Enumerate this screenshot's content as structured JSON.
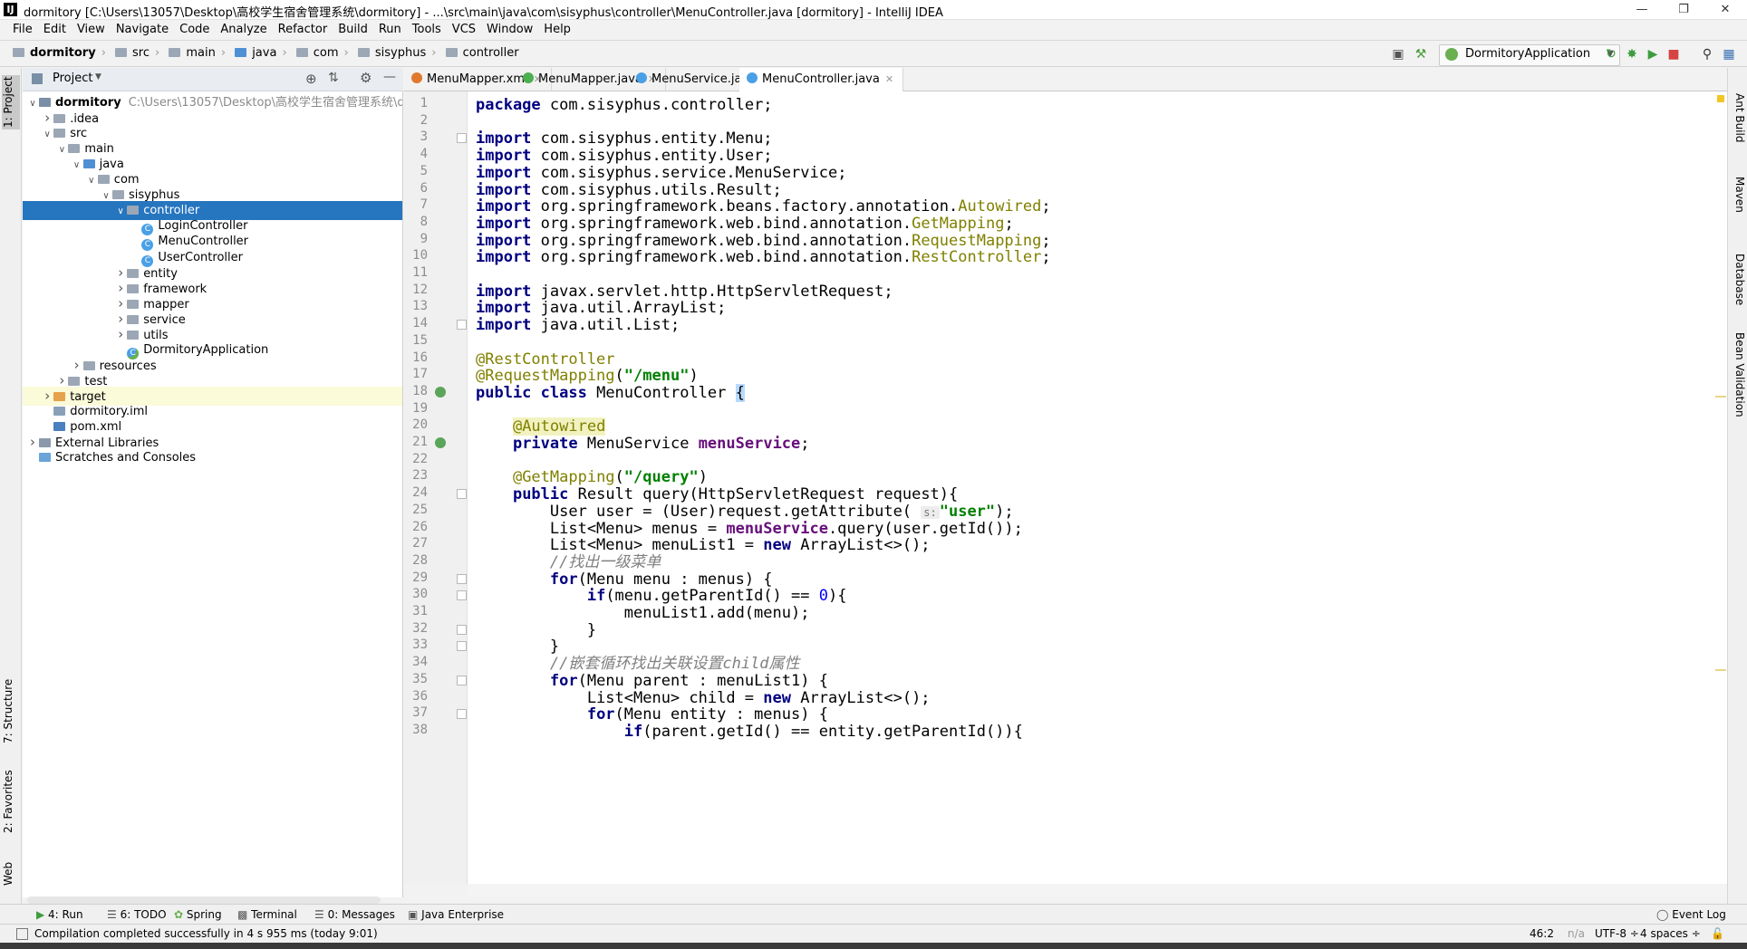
{
  "window": {
    "title": "dormitory [C:\\Users\\13057\\Desktop\\高校学生宿舍管理系统\\dormitory] - ...\\src\\main\\java\\com\\sisyphus\\controller\\MenuController.java [dormitory] - IntelliJ IDEA",
    "logo": "IJ"
  },
  "menu": [
    "File",
    "Edit",
    "View",
    "Navigate",
    "Code",
    "Analyze",
    "Refactor",
    "Build",
    "Run",
    "Tools",
    "VCS",
    "Window",
    "Help"
  ],
  "breadcrumb": [
    "dormitory",
    "src",
    "main",
    "java",
    "com",
    "sisyphus",
    "controller"
  ],
  "run_config": "DormitoryApplication",
  "left_stripe": [
    "1: Project",
    "7: Structure",
    "2: Favorites",
    "Web"
  ],
  "right_stripe": [
    "Ant Build",
    "Maven",
    "Database",
    "Bean Validation"
  ],
  "project_panel": {
    "title": "Project",
    "root_path": "C:\\Users\\13057\\Desktop\\高校学生宿舍管理系统\\dormi",
    "tree": [
      {
        "label": "dormitory",
        "depth": 0,
        "arrow": "down",
        "icon": "module",
        "bold": true
      },
      {
        "label": ".idea",
        "depth": 1,
        "arrow": "right",
        "icon": "folder"
      },
      {
        "label": "src",
        "depth": 1,
        "arrow": "down",
        "icon": "folder"
      },
      {
        "label": "main",
        "depth": 2,
        "arrow": "down",
        "icon": "folder"
      },
      {
        "label": "java",
        "depth": 3,
        "arrow": "down",
        "icon": "folder-blue"
      },
      {
        "label": "com",
        "depth": 4,
        "arrow": "down",
        "icon": "folder"
      },
      {
        "label": "sisyphus",
        "depth": 5,
        "arrow": "down",
        "icon": "folder"
      },
      {
        "label": "controller",
        "depth": 6,
        "arrow": "down",
        "icon": "folder",
        "selected": true
      },
      {
        "label": "LoginController",
        "depth": 7,
        "arrow": "",
        "icon": "class"
      },
      {
        "label": "MenuController",
        "depth": 7,
        "arrow": "",
        "icon": "class"
      },
      {
        "label": "UserController",
        "depth": 7,
        "arrow": "",
        "icon": "class"
      },
      {
        "label": "entity",
        "depth": 6,
        "arrow": "right",
        "icon": "folder"
      },
      {
        "label": "framework",
        "depth": 6,
        "arrow": "right",
        "icon": "folder"
      },
      {
        "label": "mapper",
        "depth": 6,
        "arrow": "right",
        "icon": "folder"
      },
      {
        "label": "service",
        "depth": 6,
        "arrow": "right",
        "icon": "folder"
      },
      {
        "label": "utils",
        "depth": 6,
        "arrow": "right",
        "icon": "folder"
      },
      {
        "label": "DormitoryApplication",
        "depth": 6,
        "arrow": "",
        "icon": "spring-class"
      },
      {
        "label": "resources",
        "depth": 3,
        "arrow": "right",
        "icon": "folder"
      },
      {
        "label": "test",
        "depth": 2,
        "arrow": "right",
        "icon": "folder"
      },
      {
        "label": "target",
        "depth": 1,
        "arrow": "right",
        "icon": "folder-orange",
        "highlight": true
      },
      {
        "label": "dormitory.iml",
        "depth": 1,
        "arrow": "",
        "icon": "iml"
      },
      {
        "label": "pom.xml",
        "depth": 1,
        "arrow": "",
        "icon": "maven"
      },
      {
        "label": "External Libraries",
        "depth": 0,
        "arrow": "right",
        "icon": "libraries"
      },
      {
        "label": "Scratches and Consoles",
        "depth": 0,
        "arrow": "",
        "icon": "scratches"
      }
    ]
  },
  "editor_tabs": [
    {
      "label": "MenuMapper.xml",
      "icon_color": "#e0782e",
      "active": false
    },
    {
      "label": "MenuMapper.java",
      "icon_color": "#4caf50",
      "active": false
    },
    {
      "label": "MenuService.java",
      "icon_color": "#4aa0e6",
      "active": false
    },
    {
      "label": "MenuController.java",
      "icon_color": "#4aa0e6",
      "active": true
    }
  ],
  "code_lines": [
    [
      [
        "kw",
        "package"
      ],
      [
        "",
        "com.sisyphus.controller;"
      ]
    ],
    [],
    [
      [
        "kw",
        "import"
      ],
      [
        "",
        "com.sisyphus.entity.Menu;"
      ]
    ],
    [
      [
        "kw",
        "import"
      ],
      [
        "",
        "com.sisyphus.entity.User;"
      ]
    ],
    [
      [
        "kw",
        "import"
      ],
      [
        "",
        "com.sisyphus.service.MenuService;"
      ]
    ],
    [
      [
        "kw",
        "import"
      ],
      [
        "",
        "com.sisyphus.utils.Result;"
      ]
    ],
    [
      [
        "kw",
        "import"
      ],
      [
        "",
        "org.springframework.beans.factory.annotation."
      ],
      [
        "an",
        "Autowired"
      ],
      [
        "",
        ";"
      ]
    ],
    [
      [
        "kw",
        "import"
      ],
      [
        "",
        "org.springframework.web.bind.annotation."
      ],
      [
        "an",
        "GetMapping"
      ],
      [
        "",
        ";"
      ]
    ],
    [
      [
        "kw",
        "import"
      ],
      [
        "",
        "org.springframework.web.bind.annotation."
      ],
      [
        "an",
        "RequestMapping"
      ],
      [
        "",
        ";"
      ]
    ],
    [
      [
        "kw",
        "import"
      ],
      [
        "",
        "org.springframework.web.bind.annotation."
      ],
      [
        "an",
        "RestController"
      ],
      [
        "",
        ";"
      ]
    ],
    [],
    [
      [
        "kw",
        "import"
      ],
      [
        "",
        "javax.servlet.http.HttpServletRequest;"
      ]
    ],
    [
      [
        "kw",
        "import"
      ],
      [
        "",
        "java.util.ArrayList;"
      ]
    ],
    [
      [
        "kw",
        "import"
      ],
      [
        "",
        "java.util.List;"
      ]
    ],
    [],
    [
      [
        "an",
        "@RestController"
      ]
    ],
    [
      [
        "an",
        "@RequestMapping"
      ],
      [
        "",
        "("
      ],
      [
        "str",
        "\"/menu\""
      ],
      [
        "",
        ")"
      ]
    ],
    [
      [
        "kw",
        "public class"
      ],
      [
        "",
        "MenuController "
      ],
      [
        "brace",
        "{"
      ]
    ],
    [],
    [
      [
        "",
        "    "
      ],
      [
        "anhl",
        "@Autowired"
      ]
    ],
    [
      [
        "",
        "    "
      ],
      [
        "kw",
        "private"
      ],
      [
        "",
        "MenuService "
      ],
      [
        "fld",
        "menuService"
      ],
      [
        "",
        ";"
      ]
    ],
    [],
    [
      [
        "",
        "    "
      ],
      [
        "an",
        "@GetMapping"
      ],
      [
        "",
        "("
      ],
      [
        "str",
        "\"/query\""
      ],
      [
        "",
        ")"
      ]
    ],
    [
      [
        "",
        "    "
      ],
      [
        "kw",
        "public"
      ],
      [
        "",
        "Result query(HttpServletRequest request){"
      ]
    ],
    [
      [
        "",
        "        User user = (User)request.getAttribute( "
      ],
      [
        "hint",
        "s:"
      ],
      [
        "str",
        "\"user\""
      ],
      [
        "",
        ");"
      ]
    ],
    [
      [
        "",
        "        List<Menu> menus = "
      ],
      [
        "fld",
        "menuService"
      ],
      [
        "",
        ".query(user.getId());"
      ]
    ],
    [
      [
        "",
        "        List<Menu> menuList1 = "
      ],
      [
        "kw",
        "new"
      ],
      [
        "",
        "ArrayList<>();"
      ]
    ],
    [
      [
        "",
        "        "
      ],
      [
        "cm",
        "//找出一级菜单"
      ]
    ],
    [
      [
        "",
        "        "
      ],
      [
        "kw",
        "for"
      ],
      [
        "",
        "(Menu menu : menus) {"
      ]
    ],
    [
      [
        "",
        "            "
      ],
      [
        "kw",
        "if"
      ],
      [
        "",
        "(menu.getParentId() == "
      ],
      [
        "num",
        "0"
      ],
      [
        "",
        "){"
      ]
    ],
    [
      [
        "",
        "                menuList1.add(menu);"
      ]
    ],
    [
      [
        "",
        "            }"
      ]
    ],
    [
      [
        "",
        "        }"
      ]
    ],
    [
      [
        "",
        "        "
      ],
      [
        "cm",
        "//嵌套循环找出关联设置child属性"
      ]
    ],
    [
      [
        "",
        "        "
      ],
      [
        "kw",
        "for"
      ],
      [
        "",
        "(Menu parent : menuList1) {"
      ]
    ],
    [
      [
        "",
        "            List<Menu> child = "
      ],
      [
        "kw",
        "new"
      ],
      [
        "",
        "ArrayList<>();"
      ]
    ],
    [
      [
        "",
        "            "
      ],
      [
        "kw",
        "for"
      ],
      [
        "",
        "(Menu entity : menus) {"
      ]
    ],
    [
      [
        "",
        "                "
      ],
      [
        "kw",
        "if"
      ],
      [
        "",
        "(parent.getId() == entity.getParentId()){"
      ]
    ]
  ],
  "tool_windows": [
    "4: Run",
    "6: TODO",
    "Spring",
    "Terminal",
    "0: Messages",
    "Java Enterprise"
  ],
  "event_log": "Event Log",
  "status": {
    "message": "Compilation completed successfully in 4 s 955 ms (today 9:01)",
    "position": "46:2",
    "line_sep": "n/a",
    "encoding": "UTF-8 ÷",
    "indent": "4 spaces ÷"
  }
}
